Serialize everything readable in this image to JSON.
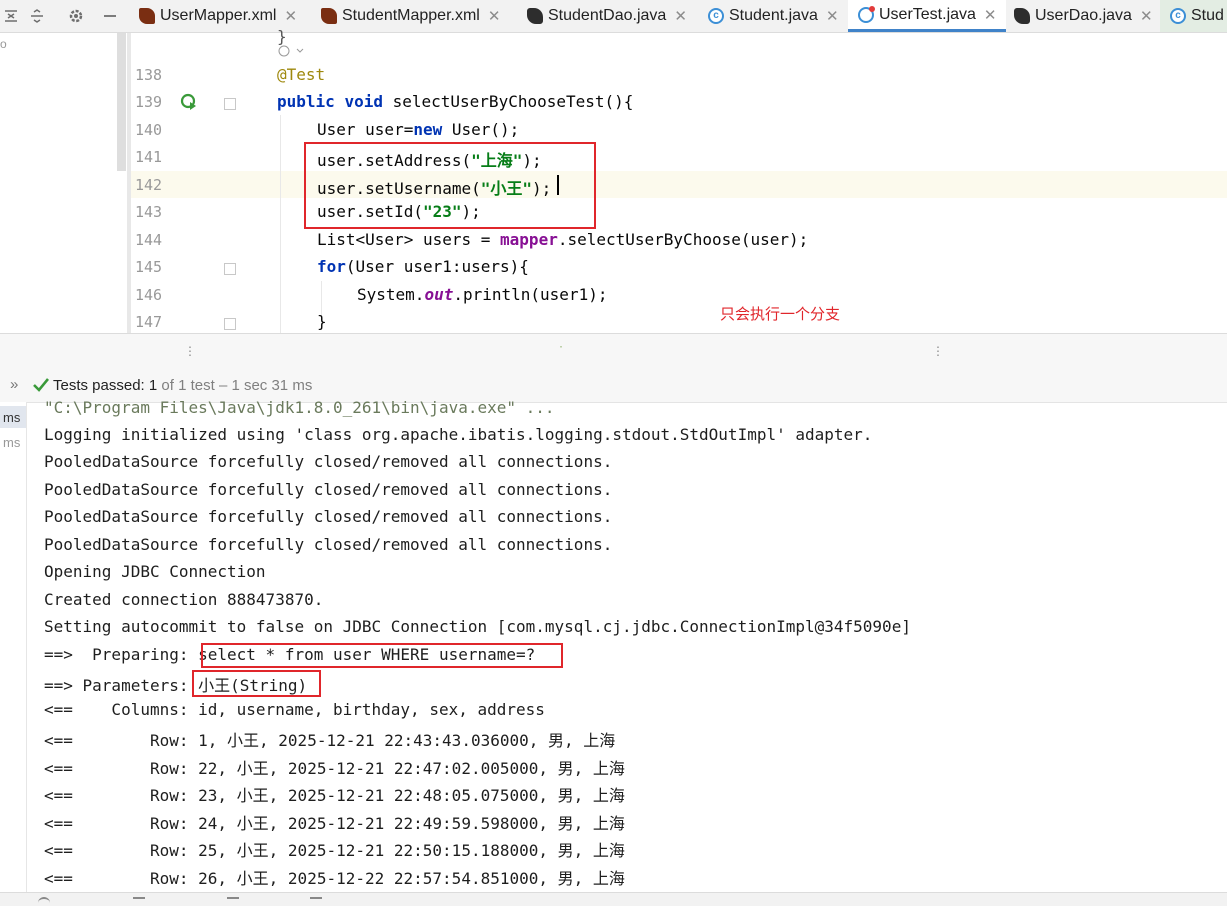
{
  "tabs": [
    {
      "label": "UserMapper.xml",
      "icon": "xml-icon"
    },
    {
      "label": "StudentMapper.xml",
      "icon": "xml-icon"
    },
    {
      "label": "StudentDao.java",
      "icon": "dao-interface-icon"
    },
    {
      "label": "Student.java",
      "icon": "class-icon"
    },
    {
      "label": "UserTest.java",
      "icon": "test-class-icon",
      "active": true
    },
    {
      "label": "UserDao.java",
      "icon": "dao-interface-icon"
    },
    {
      "label": "Stud",
      "icon": "class-icon"
    }
  ],
  "editor": {
    "line_numbers": [
      "138",
      "139",
      "140",
      "141",
      "142",
      "143",
      "144",
      "145",
      "146",
      "147"
    ],
    "lines": {
      "l138_annotation": "@Test",
      "l139_kw1": "public",
      "l139_kw2": "void",
      "l139_rest": " selectUserByChooseTest(){",
      "l140_a": "User user=",
      "l140_kw": "new",
      "l140_b": " User();",
      "l141_a": "user.setAddress(",
      "l141_str": "\"上海\"",
      "l141_b": ");",
      "l142_a": "user.setUsername(",
      "l142_str": "\"小王\"",
      "l142_b": ");",
      "l143_a": "user.setId(",
      "l143_str": "\"23\"",
      "l143_b": ");",
      "l144_a": "List<User> users = ",
      "l144_field": "mapper",
      "l144_b": ".selectUserByChoose(user);",
      "l145_kw": "for",
      "l145_rest": "(User user1:users){",
      "l146_a": "System.",
      "l146_field": "out",
      "l146_b": ".println(user1);",
      "l147": "}"
    },
    "annotation_note": "只会执行一个分支",
    "annotation_color": "#e0262b"
  },
  "test_status": {
    "passed_label": "Tests passed:",
    "passed_count": "1",
    "detail": "of 1 test – 1 sec 31 ms"
  },
  "side_labels": [
    "ms",
    "ms"
  ],
  "console": {
    "lines": [
      "\"C:\\Program Files\\Java\\jdk1.8.0_261\\bin\\java.exe\" ...",
      "Logging initialized using 'class org.apache.ibatis.logging.stdout.StdOutImpl' adapter.",
      "PooledDataSource forcefully closed/removed all connections.",
      "PooledDataSource forcefully closed/removed all connections.",
      "PooledDataSource forcefully closed/removed all connections.",
      "PooledDataSource forcefully closed/removed all connections.",
      "Opening JDBC Connection",
      "Created connection 888473870.",
      "Setting autocommit to false on JDBC Connection [com.mysql.cj.jdbc.ConnectionImpl@34f5090e]",
      "==>  Preparing: select * from user WHERE username=?",
      "==> Parameters: 小王(String)",
      "<==    Columns: id, username, birthday, sex, address",
      "<==        Row: 1, 小王, 2025-12-21 22:43:43.036000, 男, 上海",
      "<==        Row: 22, 小王, 2025-12-21 22:47:02.005000, 男, 上海",
      "<==        Row: 23, 小王, 2025-12-21 22:48:05.075000, 男, 上海",
      "<==        Row: 24, 小王, 2025-12-21 22:49:59.598000, 男, 上海",
      "<==        Row: 25, 小王, 2025-12-21 22:50:15.188000, 男, 上海",
      "<==        Row: 26, 小王, 2025-12-22 22:57:54.851000, 男, 上海"
    ]
  },
  "colors": {
    "accent_tab": "#4083c9",
    "highlight_box": "#e0262b",
    "pass_green": "#3a9a3a",
    "keyword": "#0033b3",
    "string": "#067d17"
  }
}
